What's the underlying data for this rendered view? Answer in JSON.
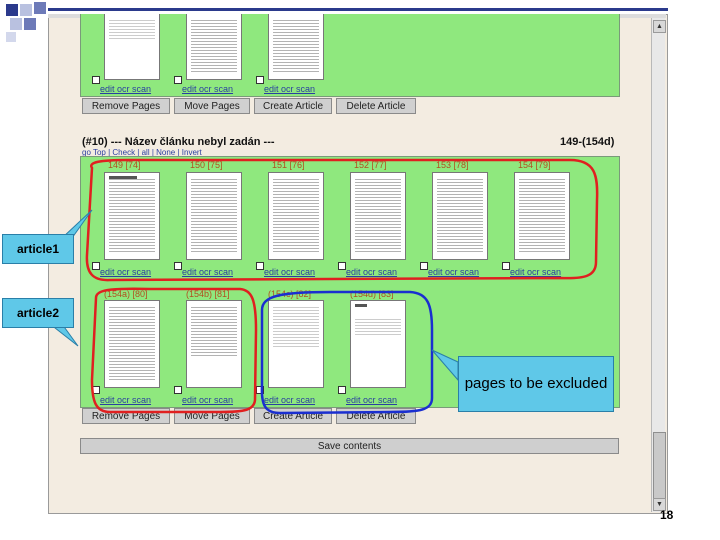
{
  "deco": {
    "accent_colors": [
      "#2b3a8c",
      "#6d7ab8",
      "#b9c1e0"
    ]
  },
  "section1": {
    "buttons": [
      "Remove Pages",
      "Move Pages",
      "Create Article",
      "Delete Article"
    ],
    "thumb_links": [
      "edit ocr scan",
      "edit ocr scan",
      "edit ocr scan"
    ]
  },
  "section2": {
    "title": "(#10) --- Název článku nebyl zadán ---",
    "range": "149-(154d)",
    "nav": "go Top | Check | all | None | Invert",
    "row1_labels": [
      "149 [74]",
      "150 [75]",
      "151 [76]",
      "152 [77]",
      "153 [78]",
      "154 [79]"
    ],
    "row1_links": [
      "edit ocr scan",
      "edit ocr scan",
      "edit ocr scan",
      "edit ocr scan",
      "edit ocr scan",
      "edit ocr scan"
    ],
    "row2_labels": [
      "(154a) [80]",
      "(154b) [81]",
      "(154c) [82]",
      "(154d) [83]"
    ],
    "row2_links": [
      "edit ocr scan",
      "edit ocr scan",
      "edit ocr scan",
      "edit ocr scan"
    ],
    "buttons": [
      "Remove Pages",
      "Move Pages",
      "Create Article",
      "Delete Article"
    ]
  },
  "save_label": "Save contents",
  "callouts": {
    "article1": "article1",
    "article2": "article2",
    "excluded": "pages to be excluded"
  },
  "highlight_colors": {
    "article": "#e02020",
    "excluded": "#1a2fd0"
  },
  "page_number": "18"
}
